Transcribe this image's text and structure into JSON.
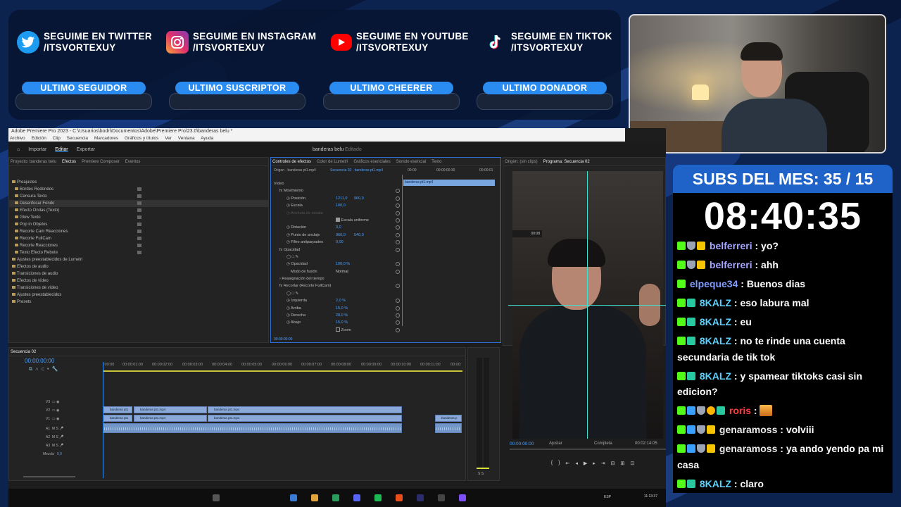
{
  "socials": [
    {
      "platform": "twitter",
      "icon": "twitter-bird-icon",
      "line1": "SEGUIME EN TWITTER",
      "line2": "/ITSVORTEXUY"
    },
    {
      "platform": "instagram",
      "icon": "instagram-icon",
      "line1": "SEGUIME EN INSTAGRAM",
      "line2": "/ITSVORTEXUY"
    },
    {
      "platform": "youtube",
      "icon": "youtube-icon",
      "line1": "SEGUIME EN YOUTUBE",
      "line2": "/ITSVORTEXUY"
    },
    {
      "platform": "tiktok",
      "icon": "tiktok-icon",
      "line1": "SEGUIME EN TIKTOK",
      "line2": "/ITSVORTEXUY"
    }
  ],
  "labels": [
    "ULTIMO SEGUIDOR",
    "ULTIMO SUSCRIPTOR",
    "ULTIMO CHEERER",
    "ULTIMO DONADOR"
  ],
  "subs": "SUBS DEL MES: 35 / 15",
  "timer": "08:40:35",
  "chat": [
    {
      "user": "belferreri",
      "text": " : yo?"
    },
    {
      "user": "belferreri",
      "text": " : ahh"
    },
    {
      "user": "elpeque34",
      "text": " : Buenos dias"
    },
    {
      "user": "8KALZ",
      "text": " : eso labura mal"
    },
    {
      "user": "8KALZ",
      "text": " : eu"
    },
    {
      "user": "8KALZ",
      "text": " : no te rinde una cuenta secundaria de tik tok"
    },
    {
      "user": "8KALZ",
      "text": " : y spamear tiktoks casi sin edicion?"
    },
    {
      "user": "roris",
      "text": " : "
    },
    {
      "user": "genaramoss",
      "text": " : volviii"
    },
    {
      "user": "genaramoss",
      "text": " : ya ando yendo pa mi casa"
    },
    {
      "user": "8KALZ",
      "text": " : claro"
    }
  ],
  "premiere": {
    "title": "Adobe Premiere Pro 2023 - C:\\Usuarios\\bodri\\Documentos\\Adobe\\Premiere Pro\\23.0\\banderas belu *",
    "menu": [
      "Archivo",
      "Edición",
      "Clip",
      "Secuencia",
      "Marcadores",
      "Gráficos y títulos",
      "Ver",
      "Ventana",
      "Ayuda"
    ],
    "workspaces": [
      "Importar",
      "Editar",
      "Exportar"
    ],
    "project_name": "banderas belu",
    "project_status": "Editado",
    "left_tabs": [
      "Proyecto: banderas belu",
      "Efectos",
      "Premiere Composer",
      "Eventos"
    ],
    "effects_tree": [
      {
        "label": "Preajustes",
        "level": 0,
        "folder": true
      },
      {
        "label": "Bordes Redondos",
        "level": 1
      },
      {
        "label": "Censura Texto",
        "level": 1
      },
      {
        "label": "Desenfocar Fondo",
        "level": 1,
        "selected": true
      },
      {
        "label": "Efecto Ondas (Texto)",
        "level": 1
      },
      {
        "label": "Glow Texto",
        "level": 1
      },
      {
        "label": "Pop in Objetos",
        "level": 1
      },
      {
        "label": "Recorte Cam Reacciones",
        "level": 1
      },
      {
        "label": "Recorte FullCam",
        "level": 1
      },
      {
        "label": "Recorte Reacciones",
        "level": 1
      },
      {
        "label": "Texto Efecto Rebote",
        "level": 1
      },
      {
        "label": "Ajustes preestablecidos de Lumetri",
        "level": 0,
        "folder": true
      },
      {
        "label": "Efectos de audio",
        "level": 0,
        "folder": true
      },
      {
        "label": "Transiciones de audio",
        "level": 0,
        "folder": true
      },
      {
        "label": "Efectos de vídeo",
        "level": 0,
        "folder": true
      },
      {
        "label": "Transiciones de vídeo",
        "level": 0,
        "folder": true
      },
      {
        "label": "Ajustes preestablecidos",
        "level": 0,
        "folder": true
      },
      {
        "label": "Presets",
        "level": 0,
        "folder": true
      }
    ],
    "ec_tabs": [
      "Controles de efectos",
      "Color de Lumetri",
      "Gráficos esenciales",
      "Sonido esencial",
      "Texto"
    ],
    "ec_source": "Origen - banderas pt1.mp4",
    "ec_seq": "Secuencia 02 - banderas pt1.mp4",
    "ec_times": [
      "00:00",
      "00:00:00:30",
      "00:00:01"
    ],
    "ec_clip": "banderas pt1.mp4",
    "ec_rows": [
      {
        "label": "Vídeo",
        "indent": 0
      },
      {
        "label": "Movimiento",
        "indent": 1
      },
      {
        "label": "Posición",
        "indent": 2,
        "v1": "1211,0",
        "v2": "960,0"
      },
      {
        "label": "Escala",
        "indent": 2,
        "v1": "180,0"
      },
      {
        "label": "Anchura de escala",
        "indent": 2
      },
      {
        "label": "",
        "indent": 2,
        "check": "Escala uniforme"
      },
      {
        "label": "Rotación",
        "indent": 2,
        "v1": "0,0"
      },
      {
        "label": "Punto de anclaje",
        "indent": 2,
        "v1": "960,0",
        "v2": "540,0"
      },
      {
        "label": "Filtro antiparpadeo",
        "indent": 2,
        "v1": "0,00"
      },
      {
        "label": "Opacidad",
        "indent": 1
      },
      {
        "label": "",
        "indent": 2,
        "shapes": true
      },
      {
        "label": "Opacidad",
        "indent": 2,
        "v1": "100,0 %"
      },
      {
        "label": "Modo de fusión",
        "indent": 2,
        "select": "Normal"
      },
      {
        "label": "Reasignación del tiempo",
        "indent": 1
      },
      {
        "label": "Recortar (Recorte FullCam)",
        "indent": 1
      },
      {
        "label": "",
        "indent": 2,
        "shapes": true
      },
      {
        "label": "Izquierda",
        "indent": 2,
        "v1": "2,0 %"
      },
      {
        "label": "Arriba",
        "indent": 2,
        "v1": "15,0 %"
      },
      {
        "label": "Derecha",
        "indent": 2,
        "v1": "28,0 %"
      },
      {
        "label": "Abajo",
        "indent": 2,
        "v1": "15,0 %"
      },
      {
        "label": "",
        "indent": 2,
        "check": "Zoom"
      }
    ],
    "ec_footer_time": "00:00:00:00",
    "src_tab": "Origen: (sin clips)",
    "prog_tab": "Programa: Secuencia 02",
    "prog_time": "00:00:00:00",
    "prog_fit": "Ajustar",
    "prog_quality": "Completa",
    "prog_duration": "00:02:14:05",
    "seq_tab": "Secuencia 02",
    "seq_time": "00:00:00:00",
    "ruler": [
      ":00:00",
      "00:00:01:00",
      "00:00:02:00",
      "00:00:03:00",
      "00:00:04:00",
      "00:00:05:00",
      "00:00:06:00",
      "00:00:07:00",
      "00:00:08:00",
      "00:00:09:00",
      "00:00:10:00",
      "00:00:11:00",
      "00:00:"
    ],
    "tracks": [
      "V3",
      "V2",
      "V1",
      "A1",
      "A2",
      "A3"
    ],
    "mix_label": "Mezcla",
    "mix_value": "0,0",
    "clips": {
      "v2": [
        {
          "label": "banderas pt1"
        },
        {
          "label": "banderas pt1.mp4"
        },
        {
          "label": "banderas pt1.mp4"
        }
      ],
      "v1": [
        {
          "label": "banderas pt1"
        },
        {
          "label": "banderas pt1.mp4"
        },
        {
          "label": "banderas pt1.mp4"
        },
        {
          "label": "banderas p"
        }
      ],
      "a1": [
        {
          "label": ""
        },
        {
          "label": ""
        }
      ]
    },
    "taskbar_time": "11:13:37",
    "taskbar_lang": "ESP"
  }
}
